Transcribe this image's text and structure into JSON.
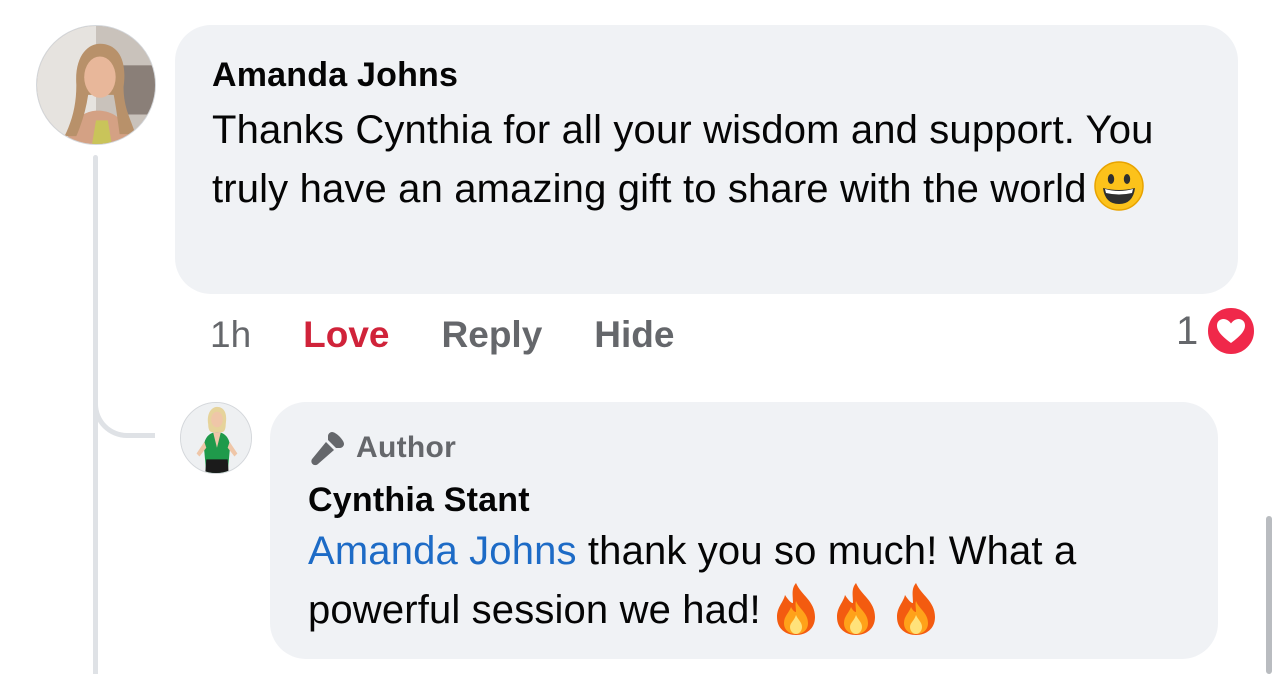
{
  "comment": {
    "author": "Amanda Johns",
    "text": "Thanks Cynthia for all your wisdom and support. You truly have an amazing gift to share with the world",
    "emoji": "grinning-face-emoji",
    "timestamp": "1h",
    "actions": {
      "love_label": "Love",
      "reply_label": "Reply",
      "hide_label": "Hide"
    },
    "reaction_count": "1",
    "reaction_icon": "heart-reaction-icon"
  },
  "reply": {
    "badge_label": "Author",
    "badge_icon": "microphone-icon",
    "author": "Cynthia Stant",
    "mention": "Amanda Johns",
    "text": " thank you so much! What a powerful session we had!",
    "emojis": [
      "fire-emoji",
      "fire-emoji",
      "fire-emoji"
    ]
  },
  "colors": {
    "bubble": "#f0f2f5",
    "love": "#d0233a",
    "mention": "#1d6bc6",
    "muted": "#65676b",
    "heart": "#f0284a"
  }
}
